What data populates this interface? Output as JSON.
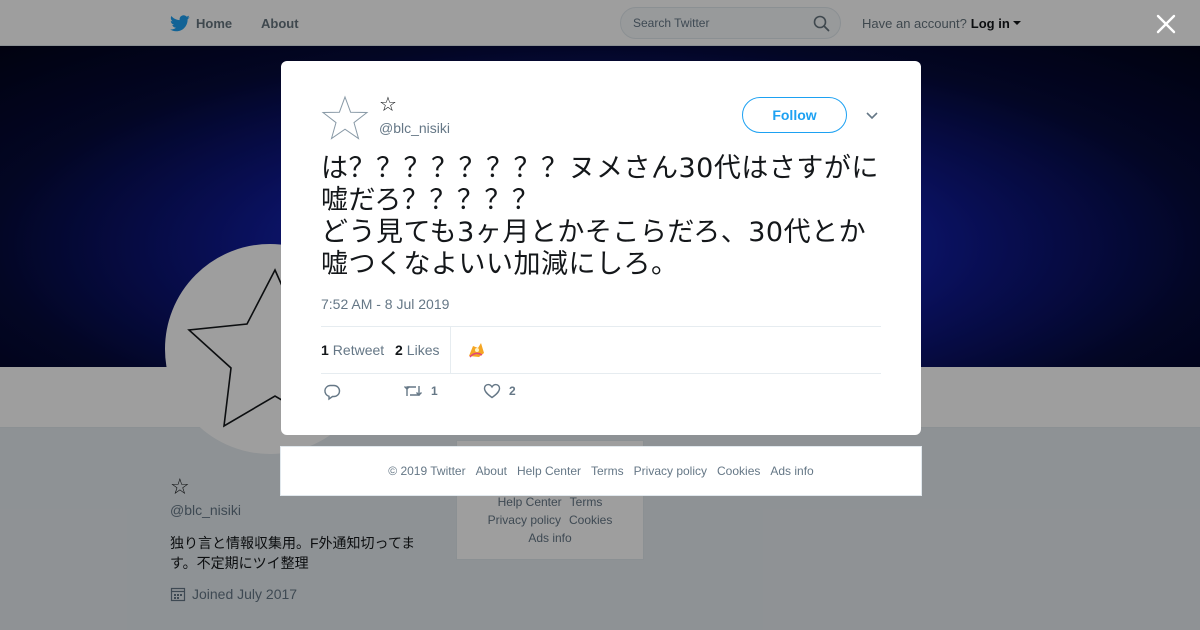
{
  "topbar": {
    "home_label": "Home",
    "about_label": "About",
    "search_placeholder": "Search Twitter",
    "account_prompt": "Have an account?",
    "login_label": "Log in"
  },
  "profile": {
    "name": "☆",
    "handle": "@blc_nisiki",
    "bio": "独り言と情報収集用。F外通知切ってます。不定期にツイ整理",
    "joined": "Joined July 2017"
  },
  "side_footer": {
    "links_row1": [
      "Help Center",
      "Terms"
    ],
    "links_row2": [
      "Privacy policy",
      "Cookies"
    ],
    "links_row3": [
      "Ads info"
    ]
  },
  "tweet": {
    "author_name": "☆",
    "author_handle": "@blc_nisiki",
    "follow_label": "Follow",
    "text": "は？？？？？？？？ヌメさん30代はさすがに嘘だろ？？？？？\nどう見ても3ヶ月とかそこらだろ、30代とか嘘つくなよいい加減にしろ。",
    "timestamp": "7:52 AM - 8 Jul 2019",
    "retweet_count": "1",
    "retweet_label": "Retweet",
    "like_count": "2",
    "like_label": "Likes",
    "action_retweet_count": "1",
    "action_like_count": "2"
  },
  "modal_footer": {
    "links": [
      "© 2019 Twitter",
      "About",
      "Help Center",
      "Terms",
      "Privacy policy",
      "Cookies",
      "Ads info"
    ]
  },
  "colors": {
    "accent": "#1da1f2",
    "text_secondary": "#657786",
    "banner_core": "#1a2ad4"
  },
  "icons": [
    "twitter-bird-icon",
    "search-icon",
    "close-icon",
    "chevron-down-icon",
    "reply-icon",
    "retweet-icon",
    "heart-icon",
    "calendar-icon",
    "star-avatar-icon"
  ]
}
